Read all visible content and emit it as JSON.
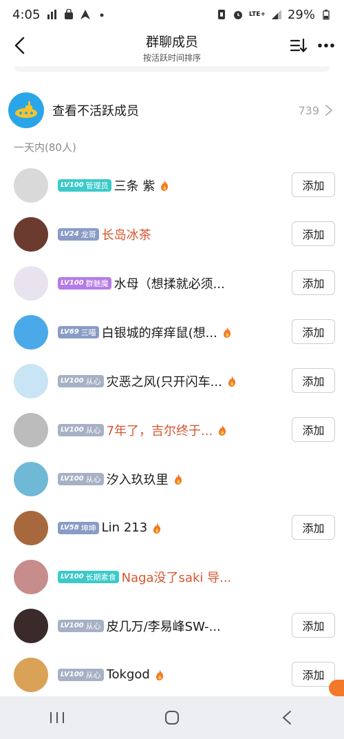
{
  "status_bar": {
    "time": "4:05",
    "network": "LTE+",
    "battery": "29%"
  },
  "header": {
    "title": "群聊成员",
    "subtitle": "按活跃时间排序"
  },
  "inactive": {
    "label": "查看不活跃成员",
    "count": "739"
  },
  "section": {
    "label": "一天内(80人)"
  },
  "add_label": "添加",
  "members": [
    {
      "level": "LV100",
      "title": "管理员",
      "badge_color": "#3cc9c9",
      "name": "三条 紫",
      "name_red": false,
      "flame": true,
      "add": true,
      "avatar_color": "#d9d9d9"
    },
    {
      "level": "LV24",
      "title": "龙哥",
      "badge_color": "#8a9cc6",
      "name": "长岛冰茶",
      "name_red": true,
      "flame": false,
      "add": true,
      "avatar_color": "#6b3b30"
    },
    {
      "level": "LV100",
      "title": "群魅魔",
      "badge_color": "#b67be6",
      "name": "水母（想揉就必须...",
      "name_red": false,
      "flame": false,
      "add": true,
      "avatar_color": "#e8e3ee"
    },
    {
      "level": "LV69",
      "title": "三喵",
      "badge_color": "#8a9cc6",
      "name": "白银城的痒痒鼠(想...",
      "name_red": false,
      "flame": true,
      "add": true,
      "avatar_color": "#4aa9e8"
    },
    {
      "level": "LV100",
      "title": "从心",
      "badge_color": "#a7b0c4",
      "name": "灾恶之风(只开闪车...",
      "name_red": false,
      "flame": true,
      "add": true,
      "avatar_color": "#c9e4f5"
    },
    {
      "level": "LV100",
      "title": "从心",
      "badge_color": "#a7b0c4",
      "name": "7年了，吉尔终于...",
      "name_red": true,
      "flame": true,
      "add": true,
      "avatar_color": "#bcbcbc"
    },
    {
      "level": "LV100",
      "title": "从心",
      "badge_color": "#a7b0c4",
      "name": "汐入玖玖里",
      "name_red": false,
      "flame": true,
      "add": false,
      "avatar_color": "#6fb8d6"
    },
    {
      "level": "LV58",
      "title": "坤坤",
      "badge_color": "#8a9cc6",
      "name": "Lin 213",
      "name_red": false,
      "flame": true,
      "add": true,
      "avatar_color": "#a8683e"
    },
    {
      "level": "LV100",
      "title": "长期素食",
      "badge_color": "#3cc9c9",
      "name": "Naga没了saki 导...",
      "name_red": true,
      "flame": false,
      "add": false,
      "avatar_color": "#c78c8c"
    },
    {
      "level": "LV100",
      "title": "从心",
      "badge_color": "#a7b0c4",
      "name": "皮几万/李易峰SW-...",
      "name_red": false,
      "flame": false,
      "add": true,
      "avatar_color": "#3a2a2a"
    },
    {
      "level": "LV100",
      "title": "从心",
      "badge_color": "#a7b0c4",
      "name": "Tokgod",
      "name_red": false,
      "flame": true,
      "add": true,
      "avatar_color": "#d9a257"
    }
  ],
  "colors": {
    "accent_orange": "#f3792a",
    "name_red": "#d8552f",
    "submarine_blue": "#2aa6e8"
  }
}
